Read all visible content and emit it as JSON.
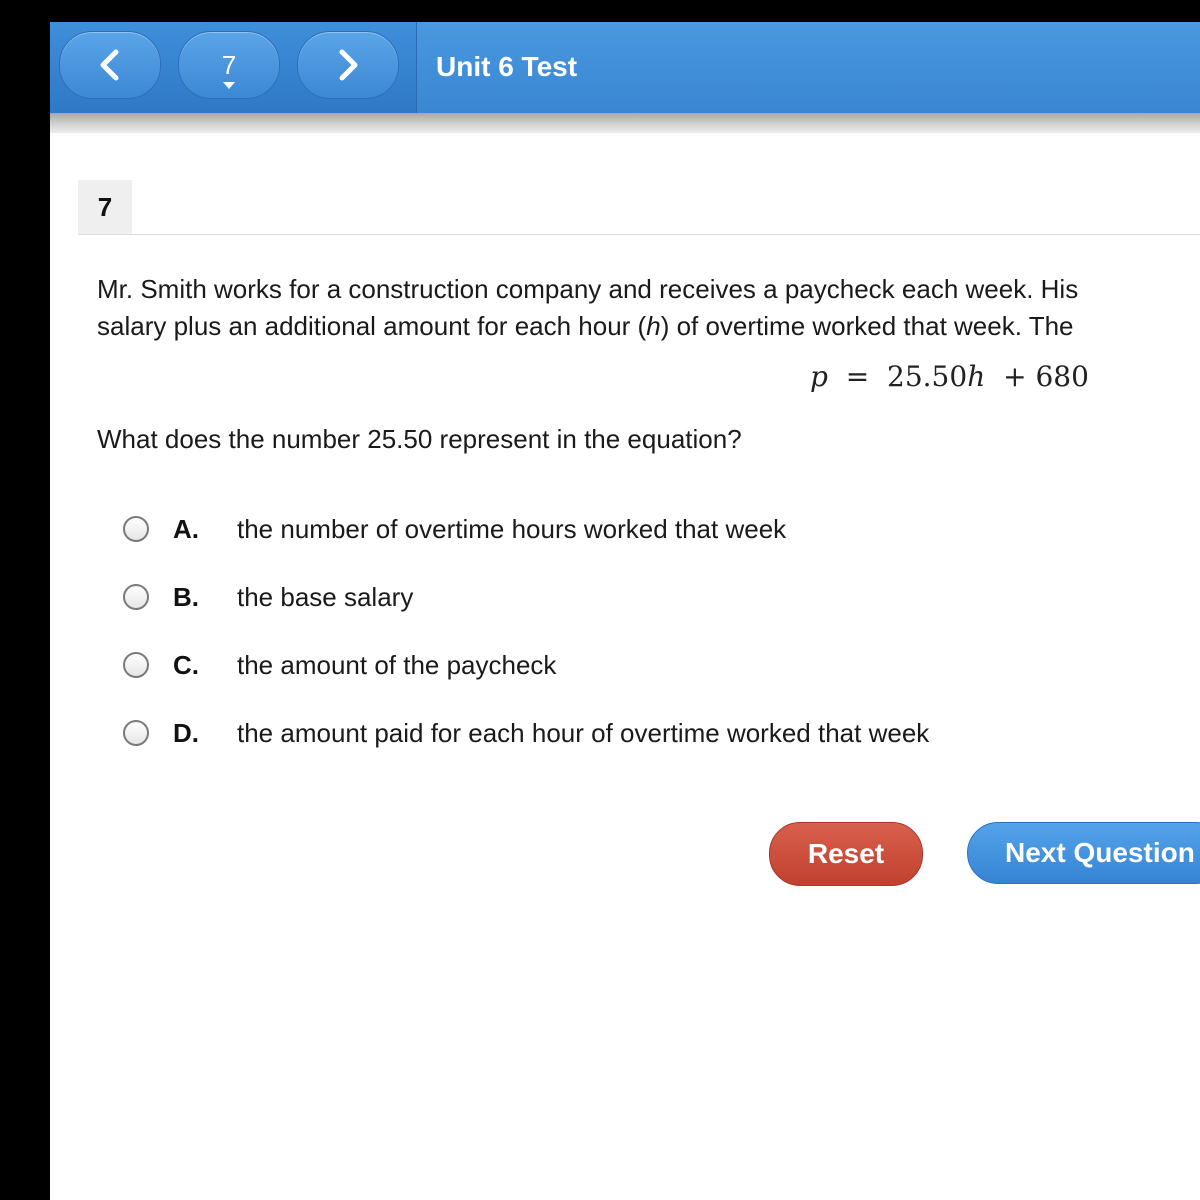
{
  "header": {
    "title": "Unit 6 Test",
    "question_selector": "7"
  },
  "question": {
    "number": "7",
    "text_line1": "Mr. Smith works for a construction company and receives a paycheck each week. His",
    "text_line2_pre": "salary plus an additional amount for each hour (",
    "text_line2_var": "h",
    "text_line2_post": ") of overtime worked that week. The",
    "equation": {
      "lhs": "p",
      "eq": "=",
      "coef": "25.50",
      "var": "h",
      "plus": "+",
      "const": "680"
    },
    "prompt": "What does the number 25.50 represent in the equation?"
  },
  "choices": [
    {
      "letter": "A.",
      "text": "the number of overtime hours worked that week"
    },
    {
      "letter": "B.",
      "text": "the base salary"
    },
    {
      "letter": "C.",
      "text": "the amount of the paycheck"
    },
    {
      "letter": "D.",
      "text": "the amount paid for each hour of overtime worked that week"
    }
  ],
  "buttons": {
    "reset": "Reset",
    "next": "Next Question"
  }
}
